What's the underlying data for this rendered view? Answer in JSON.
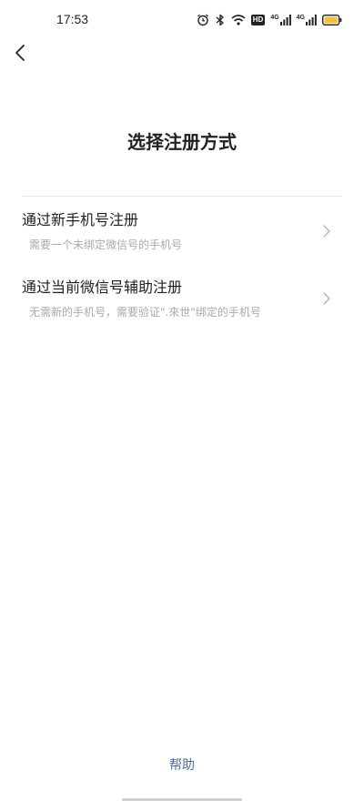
{
  "status_bar": {
    "time": "17:53",
    "icons": [
      "alarm-icon",
      "bluetooth-icon",
      "wifi-icon",
      "hd-icon",
      "signal-4g-icon",
      "signal-4g-icon",
      "battery-icon"
    ],
    "hd_label": "HD",
    "net_label_1": "4G",
    "net_label_2": "4G",
    "battery_color": "#f0c040"
  },
  "nav": {
    "back_icon": "chevron-left-icon"
  },
  "page": {
    "title": "选择注册方式"
  },
  "options": [
    {
      "title": "通过新手机号注册",
      "description": "需要一个未绑定微信号的手机号",
      "icon": "chevron-right-icon"
    },
    {
      "title": "通过当前微信号辅助注册",
      "description": "无需新的手机号，需要验证\".來世\"绑定的手机号",
      "icon": "chevron-right-icon"
    }
  ],
  "footer": {
    "help_label": "帮助",
    "help_color": "#566b94"
  }
}
